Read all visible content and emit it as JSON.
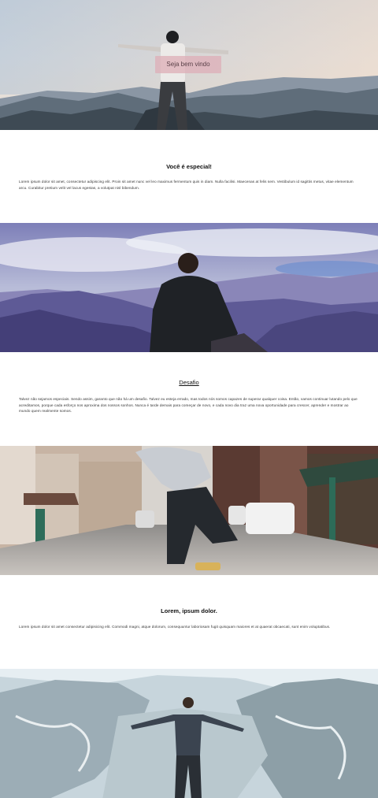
{
  "hero1": {
    "badge": "Seja bem vindo"
  },
  "section1": {
    "title": "Você é especial!",
    "text": "Lorem ipsum dolor sit amet, consectetur adipiscing elit. Proin sit amet nunc vel leo maximus fermentum quis in diam. Nulla facilisi. Maecenas at felis sem. Vestibulum id sagittis metus, vitae elementum arcu. Curabitur pretium velit vel lacus egestas, a volutpat nisl bibendum."
  },
  "section2": {
    "title": "Desafio",
    "text": "Talvez não sejamos especiais. Sendo assim, garanto que não há um desafio. Talvez eu esteja errado, mas todos nós somos capazes de superar qualquer coisa. Então, vamos continuar lutando pelo que acreditamos, porque cada esforço nos aproxima dos nossos sonhos. Nunca é tarde demais para começar de novo, e cada novo dia traz uma nova oportunidade para crescer, aprender e mostrar ao mundo quem realmente somos."
  },
  "section3": {
    "title": "Lorem, ipsum dolor.",
    "text": "Lorem ipsum dolor sit amet consectetur adipisicing elit. Commodi magni, atque dolorum, consequuntur laboriosam fugit quisquam maiores et at quaerat obcaecati, sunt enim voluptatibus."
  }
}
